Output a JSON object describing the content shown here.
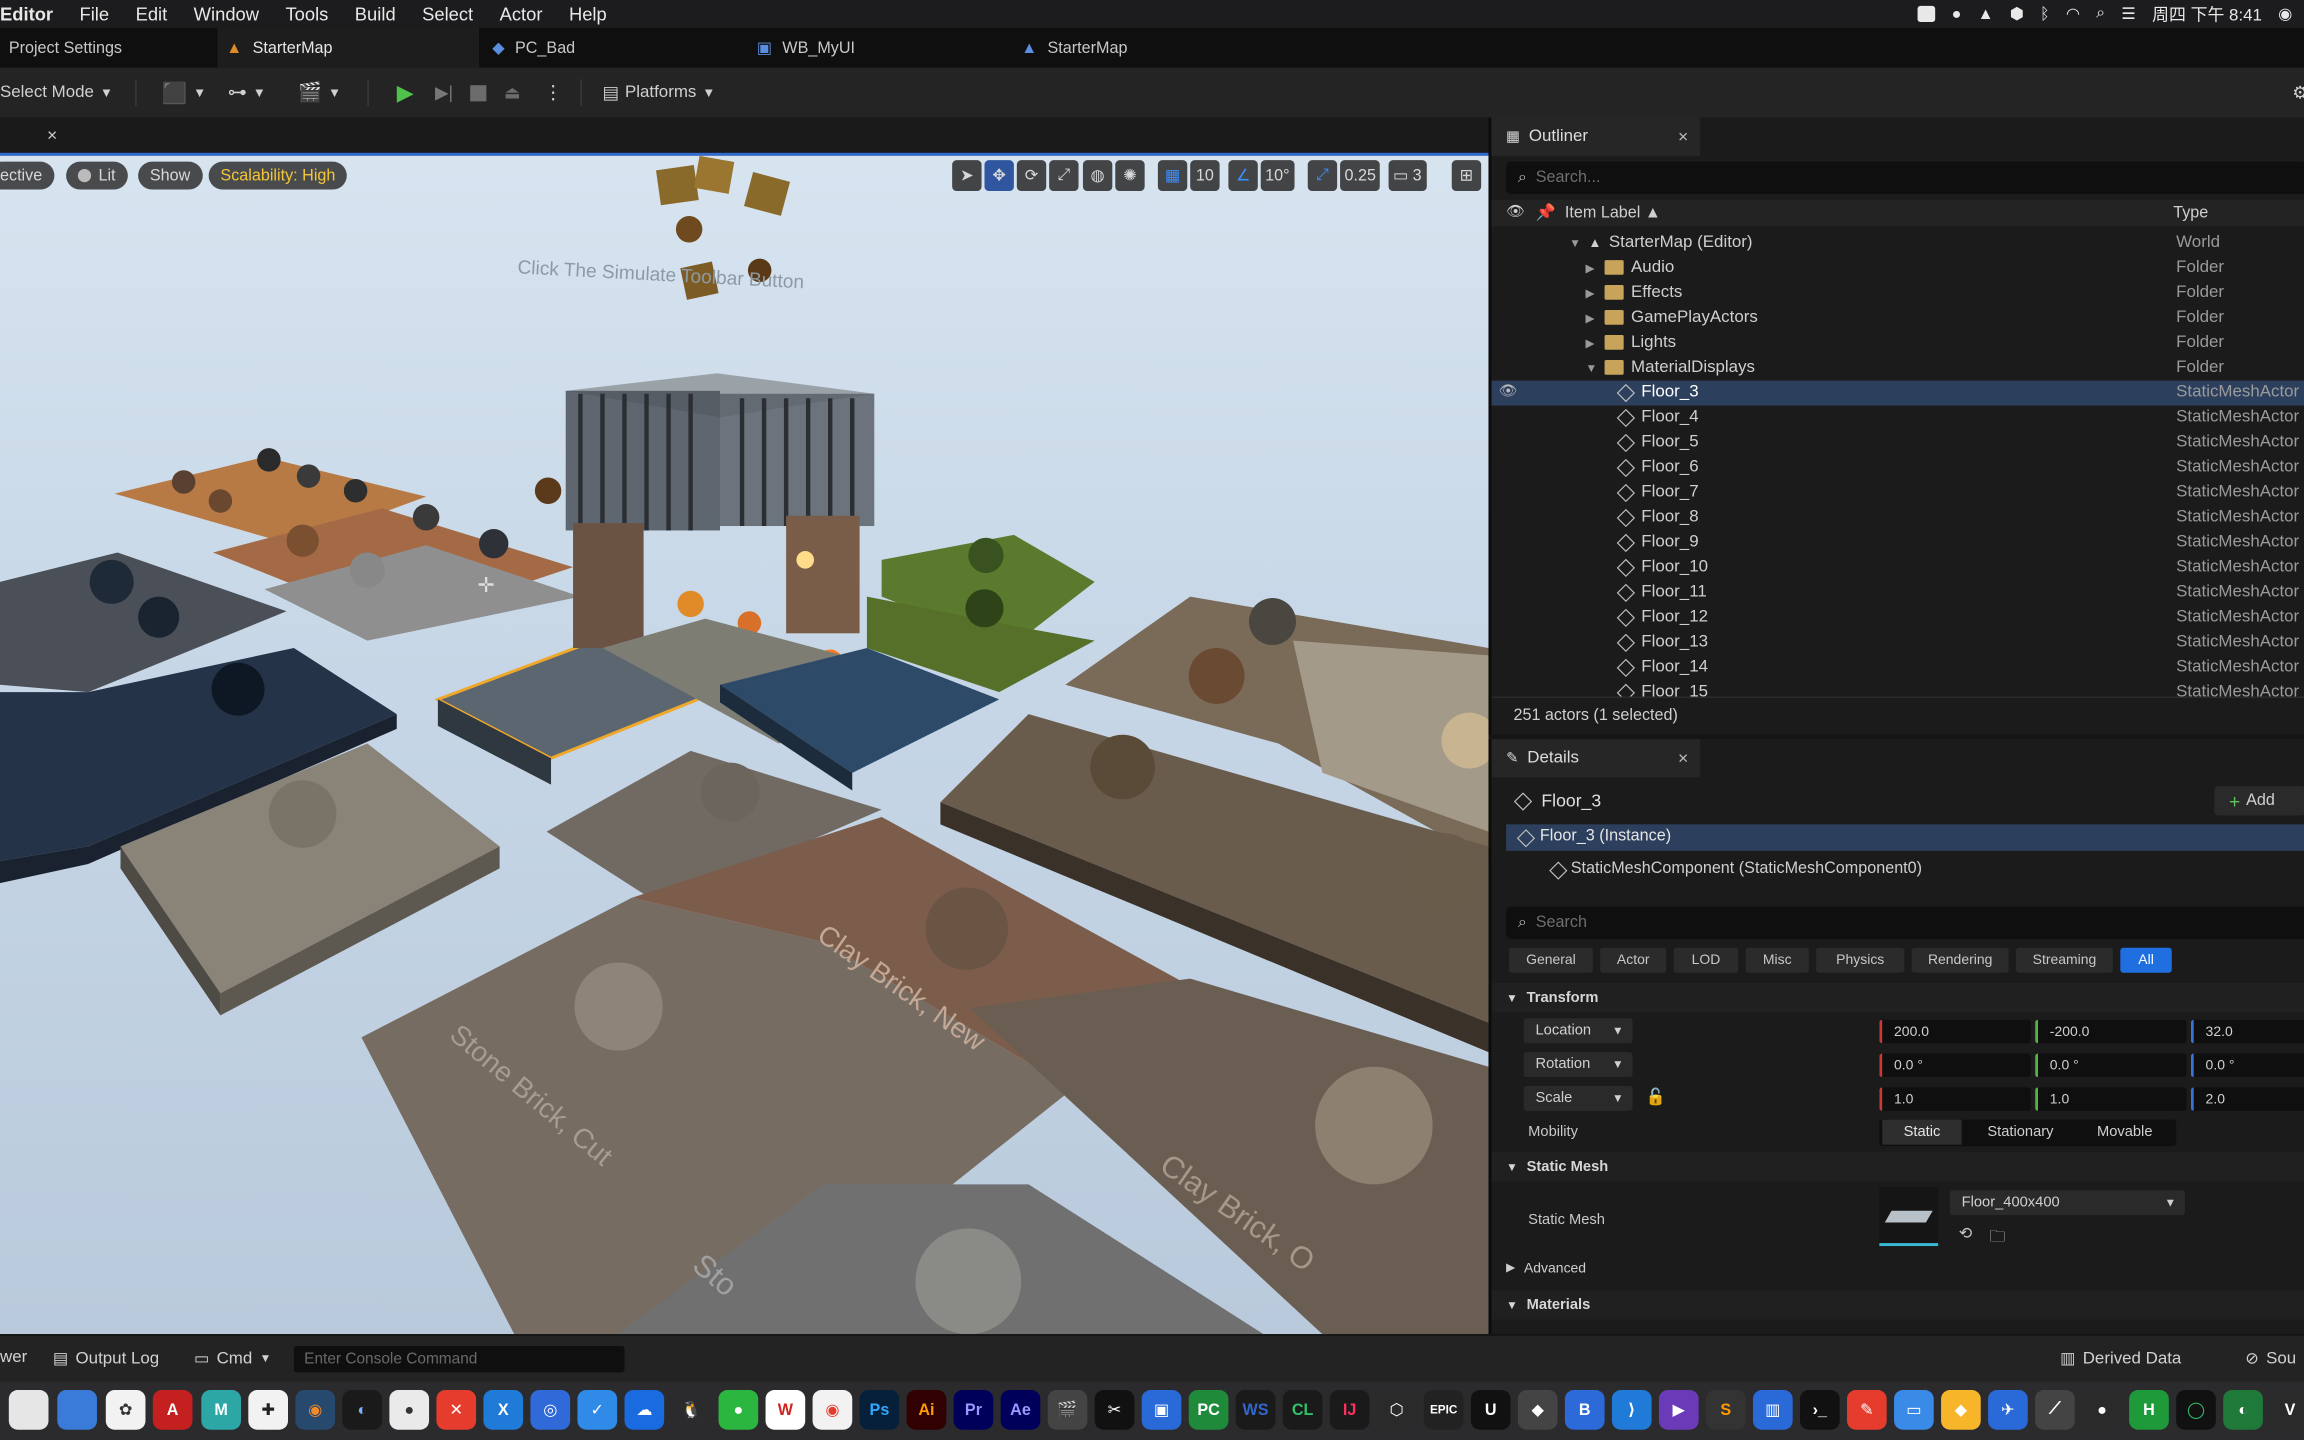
{
  "menubar": {
    "app": "Editor",
    "items": [
      "File",
      "Edit",
      "Window",
      "Tools",
      "Build",
      "Select",
      "Actor",
      "Help"
    ],
    "clock": "周四 下午 8:41"
  },
  "tabs": [
    {
      "label": "Project Settings",
      "icon": "settings-icon"
    },
    {
      "label": "StarterMap",
      "icon": "level-icon"
    },
    {
      "label": "PC_Bad",
      "icon": "gamepad-icon"
    },
    {
      "label": "WB_MyUI",
      "icon": "widget-icon"
    },
    {
      "label": "StarterMap",
      "icon": "level-icon"
    }
  ],
  "toolbar": {
    "select_mode": "Select Mode",
    "platforms": "Platforms"
  },
  "viewport": {
    "perspective": "ective",
    "lit": "Lit",
    "show": "Show",
    "scalability": "Scalability: High",
    "grid_size": "10",
    "rot_snap": "10°",
    "scale_snap": "0.25",
    "cam_speed": "3",
    "scene_labels": {
      "simulate": "Click The Simulate Toolbar Button",
      "clay_new": "Clay Brick, New",
      "stone_cut": "Stone Brick, Cut",
      "clay_old": "Clay Brick, O",
      "stone_2": "Sto"
    }
  },
  "outliner": {
    "title": "Outliner",
    "search_placeholder": "Search...",
    "col_label": "Item Label ▲",
    "col_type": "Type",
    "rows": [
      {
        "label": "StarterMap (Editor)",
        "type": "World"
      },
      {
        "label": "Audio",
        "type": "Folder"
      },
      {
        "label": "Effects",
        "type": "Folder"
      },
      {
        "label": "GamePlayActors",
        "type": "Folder"
      },
      {
        "label": "Lights",
        "type": "Folder"
      },
      {
        "label": "MaterialDisplays",
        "type": "Folder"
      },
      {
        "label": "Floor_3",
        "type": "StaticMeshActor"
      },
      {
        "label": "Floor_4",
        "type": "StaticMeshActor"
      },
      {
        "label": "Floor_5",
        "type": "StaticMeshActor"
      },
      {
        "label": "Floor_6",
        "type": "StaticMeshActor"
      },
      {
        "label": "Floor_7",
        "type": "StaticMeshActor"
      },
      {
        "label": "Floor_8",
        "type": "StaticMeshActor"
      },
      {
        "label": "Floor_9",
        "type": "StaticMeshActor"
      },
      {
        "label": "Floor_10",
        "type": "StaticMeshActor"
      },
      {
        "label": "Floor_11",
        "type": "StaticMeshActor"
      },
      {
        "label": "Floor_12",
        "type": "StaticMeshActor"
      },
      {
        "label": "Floor_13",
        "type": "StaticMeshActor"
      },
      {
        "label": "Floor_14",
        "type": "StaticMeshActor"
      },
      {
        "label": "Floor_15",
        "type": "StaticMeshActor"
      }
    ],
    "status": "251 actors (1 selected)"
  },
  "details": {
    "title": "Details",
    "actor_name": "Floor_3",
    "add_label": "Add",
    "instance": "Floor_3 (Instance)",
    "component": "StaticMeshComponent (StaticMeshComponent0)",
    "search_placeholder": "Search",
    "filters": [
      "General",
      "Actor",
      "LOD",
      "Misc",
      "Physics",
      "Rendering",
      "Streaming",
      "All"
    ],
    "transform_header": "Transform",
    "location_label": "Location",
    "rotation_label": "Rotation",
    "scale_label": "Scale",
    "location": [
      "200.0",
      "-200.0",
      "32.0"
    ],
    "rotation": [
      "0.0 °",
      "0.0 °",
      "0.0 °"
    ],
    "scale": [
      "1.0",
      "1.0",
      "2.0"
    ],
    "mobility_label": "Mobility",
    "mobility_options": [
      "Static",
      "Stationary",
      "Movable"
    ],
    "static_mesh_header": "Static Mesh",
    "static_mesh_label": "Static Mesh",
    "static_mesh_value": "Floor_400x400",
    "advanced": "Advanced",
    "materials_header": "Materials"
  },
  "bottom": {
    "drawer": "wer",
    "output_log": "Output Log",
    "cmd": "Cmd",
    "console_placeholder": "Enter Console Command",
    "derived_data": "Derived Data",
    "source": "Sou"
  },
  "dock": [
    "A",
    "M",
    "Ps",
    "Ai",
    "Pr",
    "Ae",
    "W",
    "PC",
    "WS",
    "CL",
    "IJ",
    "EPIC",
    "B",
    "H"
  ]
}
